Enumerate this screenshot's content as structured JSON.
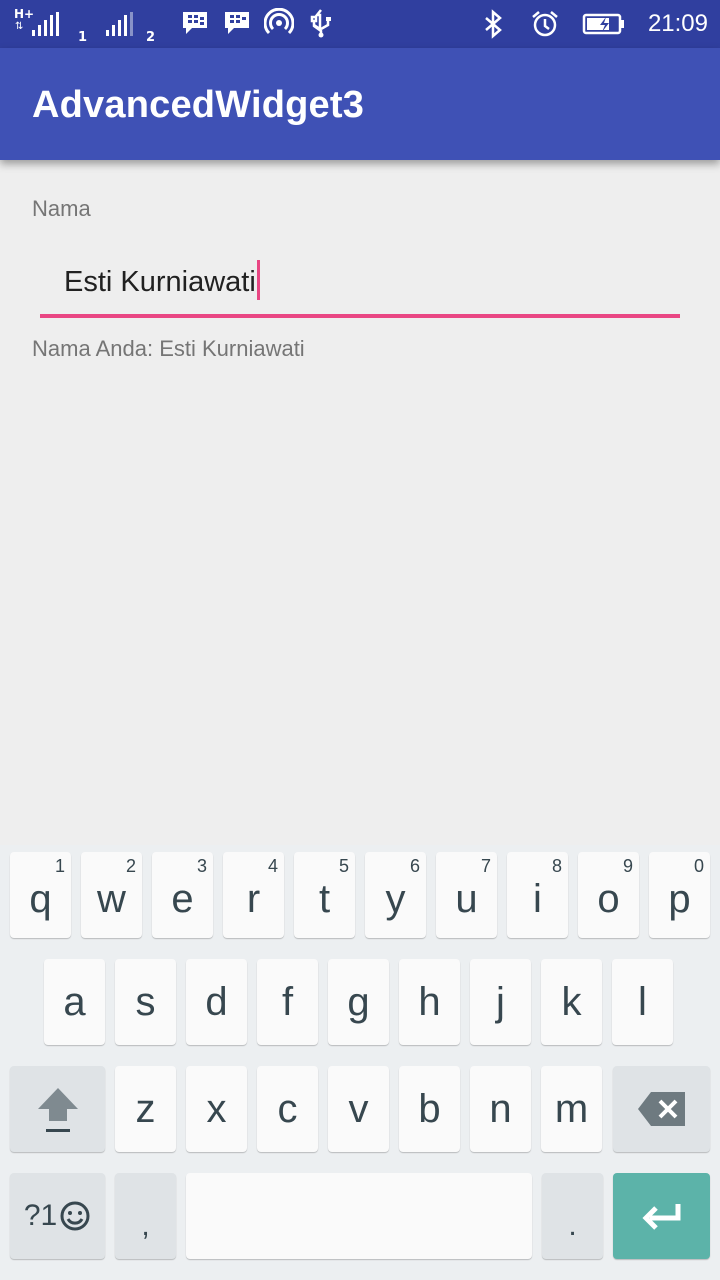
{
  "status_bar": {
    "network": "H+",
    "sim1": "1",
    "sim2": "2",
    "time": "21:09",
    "icons": [
      "signal-icon",
      "bbm-icon",
      "bbm-icon",
      "hotspot-icon",
      "usb-icon",
      "bluetooth-icon",
      "alarm-icon",
      "battery-charging-icon"
    ]
  },
  "app_bar": {
    "title": "AdvancedWidget3"
  },
  "form": {
    "label": "Nama",
    "input_value": "Esti Kurniawati",
    "result_text": "Nama Anda: Esti Kurniawati"
  },
  "keyboard": {
    "row1": [
      {
        "key": "q",
        "hint": "1"
      },
      {
        "key": "w",
        "hint": "2"
      },
      {
        "key": "e",
        "hint": "3"
      },
      {
        "key": "r",
        "hint": "4"
      },
      {
        "key": "t",
        "hint": "5"
      },
      {
        "key": "y",
        "hint": "6"
      },
      {
        "key": "u",
        "hint": "7"
      },
      {
        "key": "i",
        "hint": "8"
      },
      {
        "key": "o",
        "hint": "9"
      },
      {
        "key": "p",
        "hint": "0"
      }
    ],
    "row2": [
      "a",
      "s",
      "d",
      "f",
      "g",
      "h",
      "j",
      "k",
      "l"
    ],
    "row3": [
      "z",
      "x",
      "c",
      "v",
      "b",
      "n",
      "m"
    ],
    "symbols_label": "?1",
    "comma": ",",
    "period": "."
  },
  "colors": {
    "status_bar": "#303f9f",
    "app_bar": "#3f51b5",
    "accent": "#e94683",
    "enter_key": "#5cb3a9"
  }
}
